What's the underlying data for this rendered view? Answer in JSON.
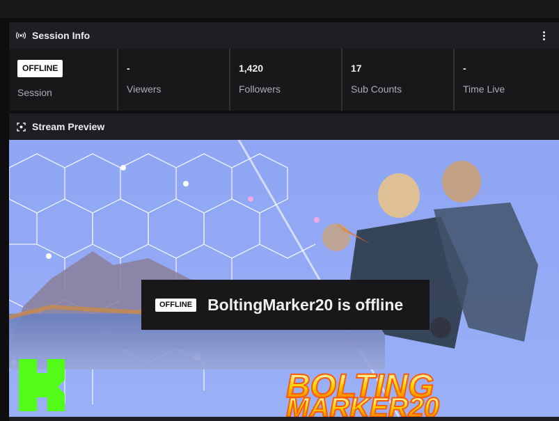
{
  "session": {
    "title": "Session Info",
    "stats": [
      {
        "value": "OFFLINE",
        "label": "Session",
        "is_badge": true
      },
      {
        "value": "-",
        "label": "Viewers"
      },
      {
        "value": "1,420",
        "label": "Followers"
      },
      {
        "value": "17",
        "label": "Sub Counts"
      },
      {
        "value": "-",
        "label": "Time Live"
      }
    ]
  },
  "preview": {
    "title": "Stream Preview",
    "badge": "OFFLINE",
    "message": "BoltingMarker20 is offline",
    "banner_text_line1": "BOLTING",
    "banner_text_line2": "MARKER20",
    "logo_letter": "K"
  },
  "colors": {
    "accent_logo": "#53fc18",
    "banner_text": "#ff5a00",
    "panel_bg": "#1f1f23",
    "page_bg": "#0e0e10"
  },
  "icons": {
    "session": "broadcast-icon",
    "preview": "screen-capture-icon",
    "menu": "kebab-menu-icon"
  }
}
